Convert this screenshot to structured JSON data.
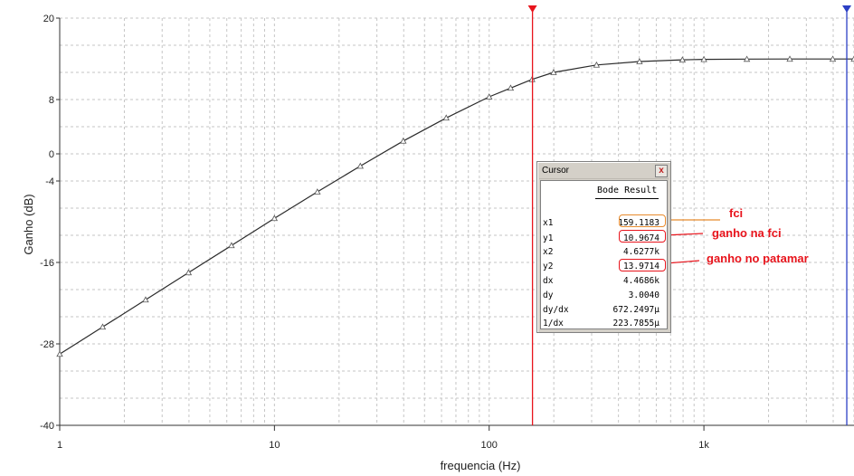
{
  "chart_data": {
    "type": "line",
    "xscale": "log",
    "xlim": [
      1,
      5000
    ],
    "ylim": [
      -40,
      20
    ],
    "xlabel": "frequencia (Hz)",
    "ylabel": "Ganho (dB)",
    "x_tick_labels": [
      "1",
      "10",
      "100",
      "1k"
    ],
    "x_tick_values": [
      1,
      10,
      100,
      1000
    ],
    "y_tick_labels": [
      "20",
      "8",
      "0",
      "-4",
      "-16",
      "-28",
      "-40"
    ],
    "y_tick_values": [
      20,
      8,
      0,
      -4,
      -16,
      -28,
      -40
    ],
    "grid": true,
    "series": [
      {
        "color": "#2b2b2b",
        "x": [
          1,
          1.585,
          2.512,
          3.981,
          6.31,
          10,
          15.85,
          25.12,
          39.81,
          63.1,
          100,
          125.9,
          158.5,
          199.5,
          316.2,
          501.2,
          794.3,
          1000,
          1585,
          2512,
          3981,
          5000
        ],
        "y": [
          -29.5,
          -25.5,
          -21.5,
          -17.5,
          -13.5,
          -9.5,
          -5.6,
          -1.8,
          1.9,
          5.3,
          8.4,
          9.7,
          10.97,
          12.0,
          13.1,
          13.6,
          13.85,
          13.92,
          13.96,
          13.97,
          13.97,
          13.97
        ]
      }
    ],
    "cursors": [
      {
        "name": "cursor-1",
        "x": 159.1183,
        "color": "#e8141c"
      },
      {
        "name": "cursor-2",
        "x": 4627.7,
        "color": "#2b3fc4"
      }
    ],
    "annotations": [
      "fci",
      "ganho na fci",
      "ganho no patamar"
    ]
  },
  "cursor_window": {
    "title": "Cursor",
    "close_label": "x",
    "header": "Bode Result",
    "rows": [
      {
        "key": "x1",
        "value": "159.1183"
      },
      {
        "key": "y1",
        "value": "10.9674"
      },
      {
        "key": "x2",
        "value": "4.6277k"
      },
      {
        "key": "y2",
        "value": "13.9714"
      },
      {
        "key": "dx",
        "value": "4.4686k"
      },
      {
        "key": "dy",
        "value": "3.0040"
      },
      {
        "key": "dy/dx",
        "value": "672.2497µ"
      },
      {
        "key": "1/dx",
        "value": "223.7855µ"
      }
    ]
  },
  "colors": {
    "annotation": "#e8141c",
    "highlight_box": "#e88a2c",
    "highlight_box_red": "#e8141c"
  }
}
